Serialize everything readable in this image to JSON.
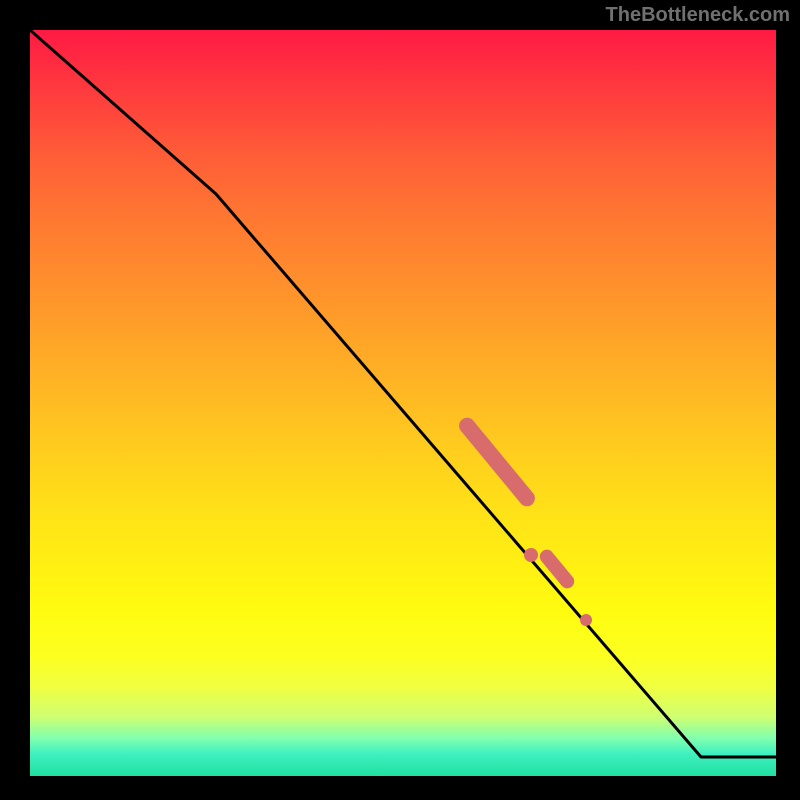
{
  "watermark": "TheBottleneck.com",
  "chart_data": {
    "type": "line",
    "title": "",
    "xlabel": "",
    "ylabel": "",
    "xlim": [
      0,
      100
    ],
    "ylim": [
      0,
      100
    ],
    "grid": false,
    "axes_visible": false,
    "background_gradient": {
      "orientation": "vertical",
      "stops": [
        {
          "pos": 0.0,
          "color": "#ff1a44"
        },
        {
          "pos": 0.5,
          "color": "#ffcc1e"
        },
        {
          "pos": 0.85,
          "color": "#fcff20"
        },
        {
          "pos": 1.0,
          "color": "#20e0a0"
        }
      ]
    },
    "series": [
      {
        "name": "curve",
        "x": [
          0,
          25,
          90,
          100
        ],
        "y": [
          100,
          78,
          2.5,
          2.5
        ],
        "color": "#000000"
      }
    ],
    "highlights": [
      {
        "x_range": [
          56,
          67
        ],
        "kind": "thick-segment",
        "color": "#d86c6c"
      },
      {
        "x_range": [
          68.5,
          69.5
        ],
        "kind": "dot",
        "color": "#d86c6c"
      },
      {
        "x_range": [
          70,
          74
        ],
        "kind": "thick-segment",
        "color": "#d86c6c"
      },
      {
        "x_range": [
          76,
          77
        ],
        "kind": "dot",
        "color": "#d86c6c"
      }
    ]
  }
}
